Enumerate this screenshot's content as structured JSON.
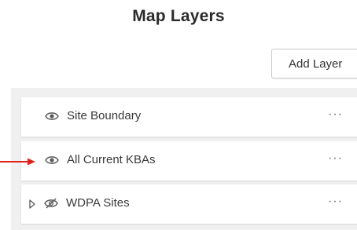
{
  "header": {
    "title": "Map Layers"
  },
  "toolbar": {
    "add_layer_label": "Add Layer"
  },
  "layers": [
    {
      "label": "Site Boundary",
      "visible": true,
      "expandable": false,
      "menu": "···",
      "eye_icon": "eye-icon"
    },
    {
      "label": "All Current KBAs",
      "visible": true,
      "expandable": false,
      "menu": "···",
      "eye_icon": "eye-icon"
    },
    {
      "label": "WDPA Sites",
      "visible": false,
      "expandable": true,
      "menu": "···",
      "eye_icon": "eye-slash-icon",
      "expander_icon": "caret-right-icon"
    }
  ],
  "annotation": {
    "arrow_icon": "arrow-right-icon",
    "arrow_color": "#e0201b"
  },
  "colors": {
    "panel_background": "#f0f0f0",
    "row_background": "#ffffff",
    "text": "#3a3a3a"
  }
}
